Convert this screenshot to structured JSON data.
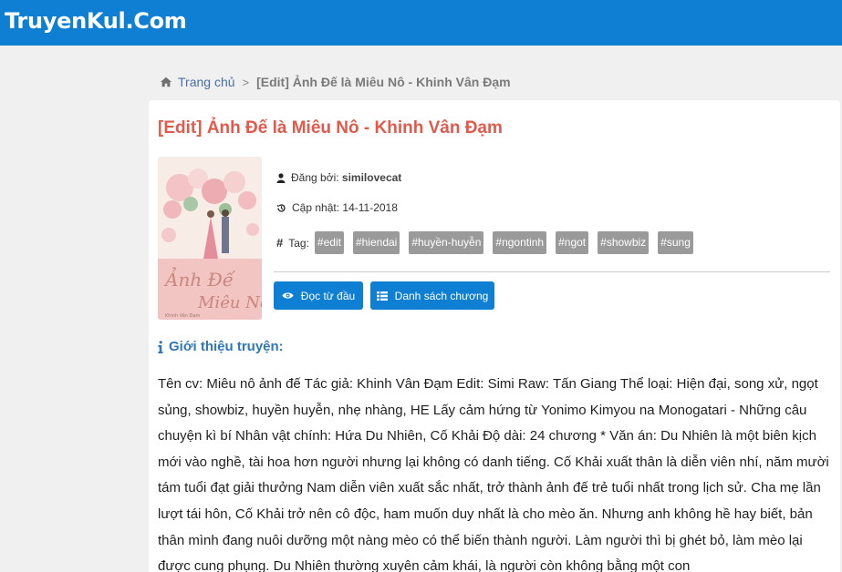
{
  "header": {
    "site_title": "TruyenKul.Com"
  },
  "breadcrumb": {
    "home_label": "Trang chủ",
    "separator": ">",
    "current": "[Edit] Ảnh Đế là Miêu Nô - Khinh Vân Đạm"
  },
  "story": {
    "title": "[Edit] Ảnh Đế là Miêu Nô - Khinh Vân Đạm",
    "cover": {
      "title_line1": "Ảnh Đế",
      "title_line2": "Miêu Nô",
      "small_text": "Khinh Vân Đạm"
    },
    "posted_by_label": "Đăng bởi:",
    "posted_by_value": "similovecat",
    "updated_label": "Cập nhật:",
    "updated_value": "14-11-2018",
    "tags_label": "Tag:",
    "tags": [
      "#edit",
      "#hiendai",
      "#huyền-huyễn",
      "#ngontinh",
      "#ngot",
      "#showbiz",
      "#sung"
    ]
  },
  "actions": {
    "read_from_start": "Đọc từ đầu",
    "chapter_list": "Danh sách chương"
  },
  "intro": {
    "heading": "Giới thiệu truyện:",
    "text": "Tên cv: Miêu nô ảnh đế Tác giả: Khinh Vân Đạm Edit: Simi Raw: Tấn Giang Thể loại: Hiện đại, song xử, ngọt sủng, showbiz, huyền huyễn, nhẹ nhàng, HE Lấy cảm hứng từ Yonimo Kimyou na Monogatari - Những câu chuyện kì bí Nhân vật chính: Hứa Du Nhiên, Cố Khải Độ dài: 24 chương * Văn án: Du Nhiên là một biên kịch mới vào nghề, tài hoa hơn người nhưng lại không có danh tiếng. Cố Khải xuất thân là diễn viên nhí, năm mười tám tuổi đạt giải thưởng Nam diễn viên xuất sắc nhất, trở thành ảnh đế trẻ tuổi nhất trong lịch sử. Cha mẹ lần lượt tái hôn, Cố Khải trở nên cô độc, ham muốn duy nhất là cho mèo ăn. Nhưng anh không hề hay biết, bản thân mình đang nuôi dưỡng một nàng mèo có thể biến thành người. Làm người thì bị ghét bỏ, làm mèo lại được cung phụng. Du Nhiên thường xuyên cảm khái, là người còn không bằng một con"
  }
}
